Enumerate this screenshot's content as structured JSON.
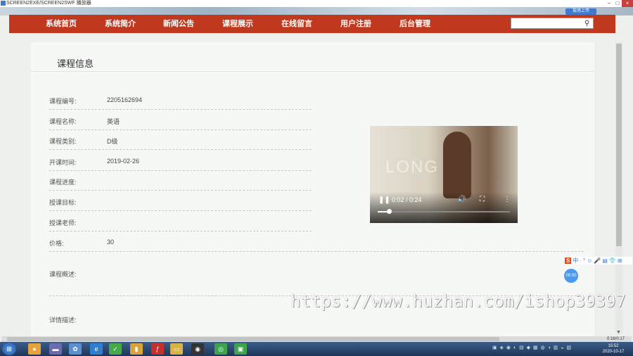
{
  "window": {
    "title": "SCREEN2EXE/SCREEN2SWF 播放器"
  },
  "upper_button": "现场上传",
  "nav": {
    "items": [
      "系统首页",
      "系统简介",
      "新闻公告",
      "课程展示",
      "在线留言",
      "用户注册",
      "后台管理"
    ]
  },
  "search": {
    "value": "",
    "placeholder": ""
  },
  "section_title": "课程信息",
  "fields": [
    {
      "label": "课程编号:",
      "value": "2205162694"
    },
    {
      "label": "课程名称:",
      "value": "英语"
    },
    {
      "label": "课程类别:",
      "value": "D级"
    },
    {
      "label": "开课时间:",
      "value": "2019-02-26"
    },
    {
      "label": "课程进度:",
      "value": ""
    },
    {
      "label": "授课目标:",
      "value": ""
    },
    {
      "label": "授课老师:",
      "value": ""
    },
    {
      "label": "价格:",
      "value": "30"
    },
    {
      "label": "课程概述:",
      "value": ""
    },
    {
      "label": "详情描述:",
      "value": ""
    }
  ],
  "video": {
    "time": "0:02 / 0:24",
    "progress_fraction": 0.083,
    "overlay_text": "LONG"
  },
  "ime": {
    "logo": "S",
    "items": [
      "中",
      "·",
      "°",
      "☺",
      "🎤",
      "▤",
      "👕",
      "⊞"
    ]
  },
  "badge": "00:00",
  "watermark": "https://www.huzhan.com/ishop39397",
  "hscroll_label": "0:16/0:17",
  "taskbar": {
    "time": "15:52",
    "date": "2020-10-17"
  }
}
